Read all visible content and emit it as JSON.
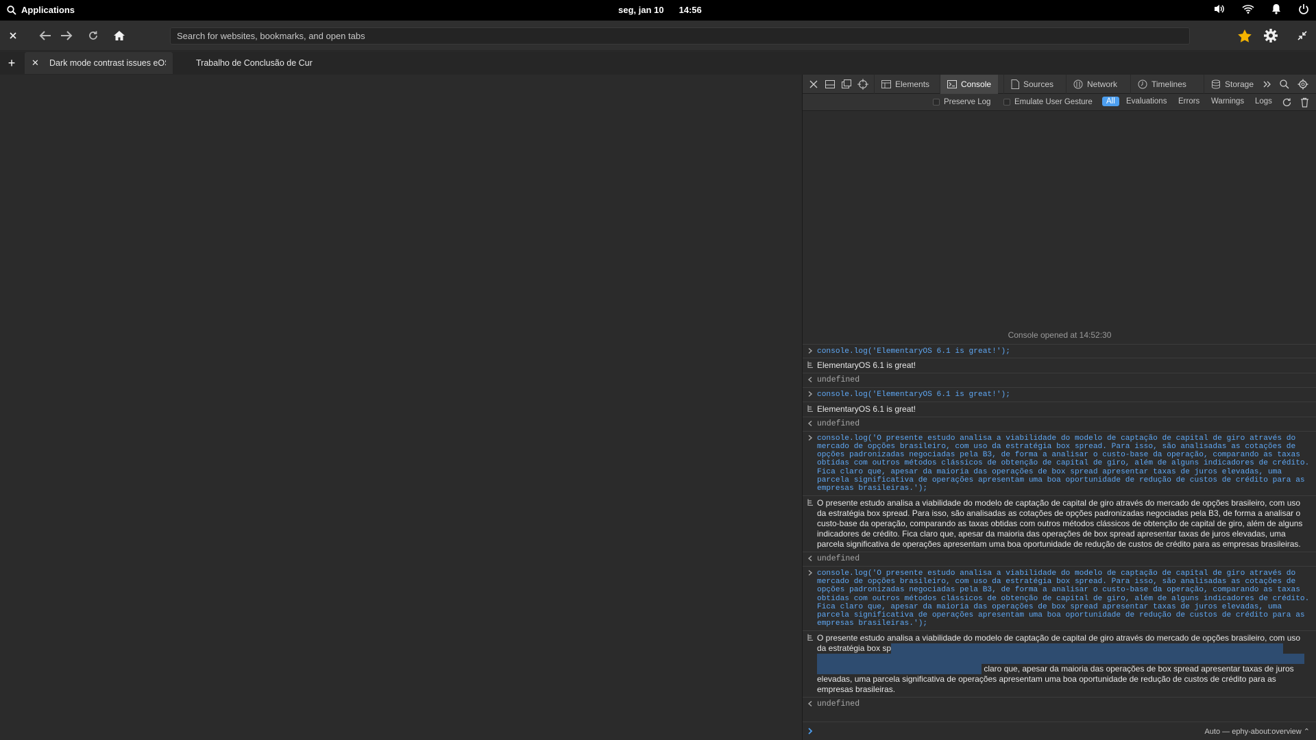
{
  "topbar": {
    "apps_label": "Applications",
    "date": "seg, jan 10",
    "time": "14:56"
  },
  "header": {
    "url_placeholder": "Search for websites, bookmarks, and open tabs"
  },
  "tabs": [
    {
      "title": "Dark mode contrast issues eOS"
    },
    {
      "title": "Trabalho de Conclusão de Cur"
    }
  ],
  "devtools": {
    "tabs": [
      "Elements",
      "Console",
      "Sources",
      "Network",
      "Timelines",
      "Storage"
    ],
    "filter": {
      "preserve_log": "Preserve Log",
      "emulate_gesture": "Emulate User Gesture",
      "levels": [
        "All",
        "Evaluations",
        "Errors",
        "Warnings",
        "Logs"
      ]
    },
    "console_opened": "Console opened at 14:52:30",
    "messages": {
      "cmd1": "console.log('ElementaryOS 6.1 is great!');",
      "log1": "ElementaryOS 6.1 is great!",
      "res1": "undefined",
      "cmd2": "console.log('ElementaryOS 6.1 is great!');",
      "log2": "ElementaryOS 6.1 is great!",
      "res2": "undefined",
      "cmd3": "console.log('O presente estudo analisa a viabilidade do modelo de captação de capital de giro através do mercado de opções brasileiro, com uso da estratégia box spread. Para isso, são analisadas as cotações de opções padronizadas negociadas pela B3, de forma a analisar o custo-base da operação, comparando as taxas obtidas com outros métodos clássicos de obtenção de capital de giro, além de alguns indicadores de crédito. Fica claro que, apesar da maioria das operações de box spread apresentar taxas de juros elevadas, uma parcela significativa de operações apresentam uma boa oportunidade de redução de custos de crédito para as empresas brasileiras.');",
      "log3": "O presente estudo analisa a viabilidade do modelo de captação de capital de giro através do mercado de opções brasileiro, com uso da estratégia box spread. Para isso, são analisadas as cotações de opções padronizadas negociadas pela B3, de forma a analisar o custo-base da operação, comparando as taxas obtidas com outros métodos clássicos de obtenção de capital de giro, além de alguns indicadores de crédito. Fica claro que, apesar da maioria das operações de box spread apresentar taxas de juros elevadas, uma parcela significativa de operações apresentam uma boa oportunidade de redução de custos de crédito para as empresas brasileiras.",
      "res3": "undefined",
      "cmd4": "console.log('O presente estudo analisa a viabilidade do modelo de captação de capital de giro através do mercado de opções brasileiro, com uso da estratégia box spread. Para isso, são analisadas as cotações de opções padronizadas negociadas pela B3, de forma a analisar o custo-base da operação, comparando as taxas obtidas com outros métodos clássicos de obtenção de capital de giro, além de alguns indicadores de crédito. Fica claro que, apesar da maioria das operações de box spread apresentar taxas de juros elevadas, uma parcela significativa de operações apresentam uma boa oportunidade de redução de custos de crédito para as empresas brasileiras.');",
      "log4_visible_start": "O presente estudo analisa a viabilidade do modelo de captação de capital de giro através do mercado de opções brasileiro, com uso da estratégia box sp",
      "log4_visible_end": "claro que, apesar da maioria das operações de box spread apresentar taxas de juros elevadas, uma parcela significativa de operações apresentam uma boa oportunidade de redução de custos de crédito para as empresas brasileiras.",
      "res4": "undefined"
    },
    "context": "Auto — ephy-about:overview"
  },
  "colors": {
    "accent": "#4d9ff0",
    "command_text": "#5fa8f5",
    "selection": "#2e4c70",
    "star": "#f5b400"
  }
}
